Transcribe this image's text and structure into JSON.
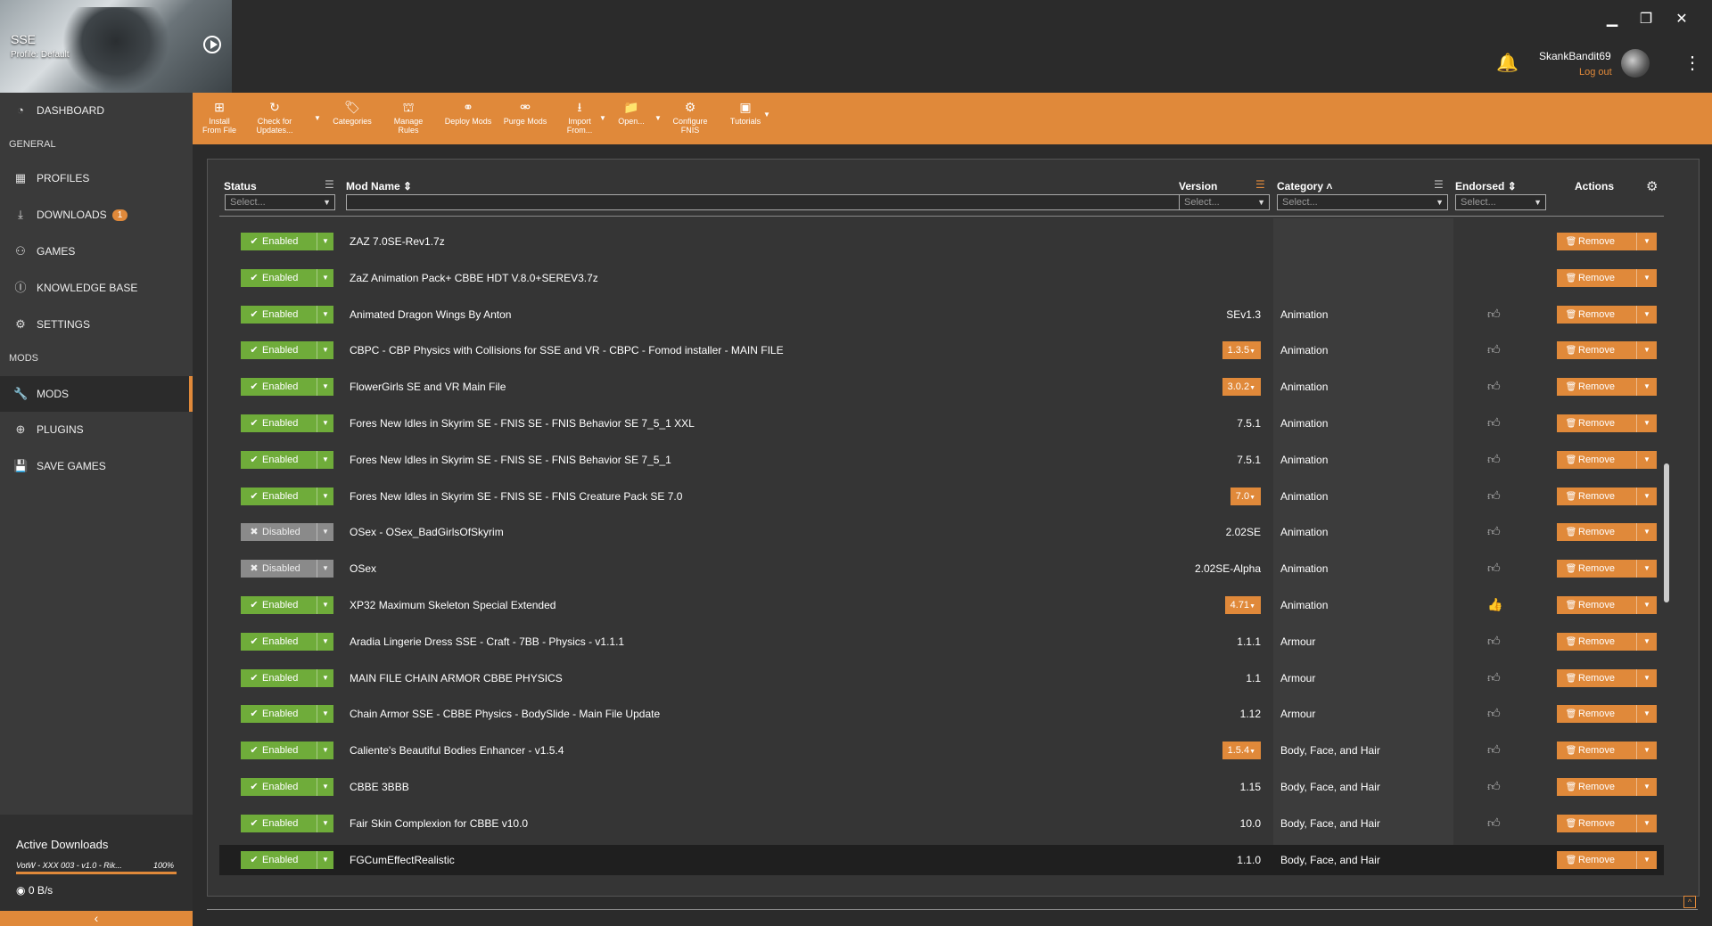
{
  "game": {
    "title": "SSE",
    "profile": "Profile: Default"
  },
  "window": {
    "minimize": "▁",
    "restore": "❐",
    "close": "✕"
  },
  "user": {
    "name": "SkankBandit69",
    "logout": "Log out"
  },
  "sidebar": {
    "dashboard": "DASHBOARD",
    "section_general": "GENERAL",
    "profiles": "PROFILES",
    "downloads": "DOWNLOADS",
    "downloads_badge": "1",
    "games": "GAMES",
    "knowledge_base": "KNOWLEDGE BASE",
    "settings": "SETTINGS",
    "section_mods": "MODS",
    "mods": "MODS",
    "plugins": "PLUGINS",
    "save_games": "SAVE GAMES"
  },
  "active_downloads": {
    "title": "Active Downloads",
    "item": "VotW - XXX 003 - v1.0 - Rik...",
    "percent": "100%",
    "progress": 1.0,
    "speed": "0 B/s"
  },
  "toolbar": {
    "install": "Install From File",
    "check_updates": "Check for Updates...",
    "categories": "Categories",
    "manage_rules": "Manage Rules",
    "deploy": "Deploy Mods",
    "purge": "Purge Mods",
    "import": "Import From...",
    "open": "Open...",
    "configure_fnis": "Configure FNIS",
    "tutorials": "Tutorials"
  },
  "table": {
    "headers": {
      "status": "Status",
      "mod_name": "Mod Name",
      "version": "Version",
      "category": "Category",
      "endorsed": "Endorsed",
      "actions": "Actions"
    },
    "filter_placeholder": "Select...",
    "rows": [
      {
        "status": "Enabled",
        "name": "ZAZ 7.0SE-Rev1.7z",
        "version": "",
        "version_update": false,
        "category": "",
        "endorsed": "none",
        "action": "Remove"
      },
      {
        "status": "Enabled",
        "name": "ZaZ Animation Pack+ CBBE HDT V.8.0+SEREV3.7z",
        "version": "",
        "version_update": false,
        "category": "",
        "endorsed": "none",
        "action": "Remove"
      },
      {
        "status": "Enabled",
        "name": "Animated Dragon Wings By Anton",
        "version": "SEv1.3",
        "version_update": false,
        "category": "Animation",
        "endorsed": "no",
        "action": "Remove"
      },
      {
        "status": "Enabled",
        "name": "CBPC - CBP Physics with Collisions for SSE and VR - CBPC - Fomod installer - MAIN FILE",
        "version": "1.3.5",
        "version_update": true,
        "category": "Animation",
        "endorsed": "no",
        "action": "Remove"
      },
      {
        "status": "Enabled",
        "name": "FlowerGirls SE and VR Main File",
        "version": "3.0.2",
        "version_update": true,
        "category": "Animation",
        "endorsed": "no",
        "action": "Remove"
      },
      {
        "status": "Enabled",
        "name": "Fores New Idles in Skyrim SE - FNIS SE - FNIS Behavior SE 7_5_1 XXL",
        "version": "7.5.1",
        "version_update": false,
        "category": "Animation",
        "endorsed": "no",
        "action": "Remove"
      },
      {
        "status": "Enabled",
        "name": "Fores New Idles in Skyrim SE - FNIS SE - FNIS Behavior SE 7_5_1",
        "version": "7.5.1",
        "version_update": false,
        "category": "Animation",
        "endorsed": "no",
        "action": "Remove"
      },
      {
        "status": "Enabled",
        "name": "Fores New Idles in Skyrim SE - FNIS SE - FNIS Creature Pack SE 7.0",
        "version": "7.0",
        "version_update": true,
        "category": "Animation",
        "endorsed": "no",
        "action": "Remove"
      },
      {
        "status": "Disabled",
        "name": "OSex - OSex_BadGirlsOfSkyrim",
        "version": "2.02SE",
        "version_update": false,
        "category": "Animation",
        "endorsed": "no",
        "action": "Remove"
      },
      {
        "status": "Disabled",
        "name": "OSex",
        "version": "2.02SE-Alpha",
        "version_update": false,
        "category": "Animation",
        "endorsed": "no",
        "action": "Remove"
      },
      {
        "status": "Enabled",
        "name": "XP32 Maximum Skeleton Special Extended",
        "version": "4.71",
        "version_update": true,
        "category": "Animation",
        "endorsed": "yes",
        "action": "Remove"
      },
      {
        "status": "Enabled",
        "name": "Aradia Lingerie Dress SSE - Craft - 7BB - Physics - v1.1.1",
        "version": "1.1.1",
        "version_update": false,
        "category": "Armour",
        "endorsed": "no",
        "action": "Remove"
      },
      {
        "status": "Enabled",
        "name": "MAIN FILE CHAIN ARMOR CBBE PHYSICS",
        "version": "1.1",
        "version_update": false,
        "category": "Armour",
        "endorsed": "no",
        "action": "Remove"
      },
      {
        "status": "Enabled",
        "name": "Chain Armor SSE - CBBE Physics - BodySlide - Main File Update",
        "version": "1.12",
        "version_update": false,
        "category": "Armour",
        "endorsed": "no",
        "action": "Remove"
      },
      {
        "status": "Enabled",
        "name": "Caliente's Beautiful Bodies Enhancer - v1.5.4",
        "version": "1.5.4",
        "version_update": true,
        "category": "Body, Face, and Hair",
        "endorsed": "no",
        "action": "Remove"
      },
      {
        "status": "Enabled",
        "name": "CBBE 3BBB",
        "version": "1.15",
        "version_update": false,
        "category": "Body, Face, and Hair",
        "endorsed": "no",
        "action": "Remove"
      },
      {
        "status": "Enabled",
        "name": "Fair Skin Complexion for CBBE v10.0",
        "version": "10.0",
        "version_update": false,
        "category": "Body, Face, and Hair",
        "endorsed": "no",
        "action": "Remove"
      },
      {
        "status": "Enabled",
        "name": "FGCumEffectRealistic",
        "version": "1.1.0",
        "version_update": false,
        "category": "Body, Face, and Hair",
        "endorsed": "none",
        "action": "Remove"
      }
    ]
  },
  "colors": {
    "accent": "#e0893a",
    "enabled": "#6fac3a",
    "disabled": "#8a8a8a"
  }
}
